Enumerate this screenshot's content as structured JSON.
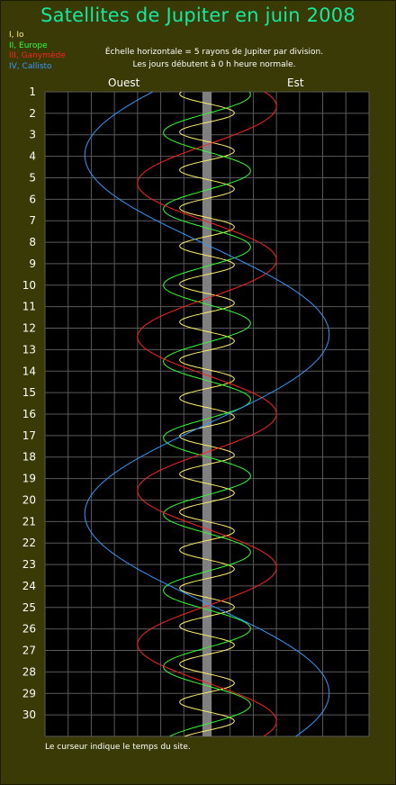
{
  "title": "Satellites de Jupiter en juin 2008",
  "legend": [
    {
      "label": "I, Io",
      "color": "#ffee66"
    },
    {
      "label": "II, Europe",
      "color": "#33ff33"
    },
    {
      "label": "III, Ganymède",
      "color": "#ff2222"
    },
    {
      "label": "IV, Callisto",
      "color": "#3399ff"
    }
  ],
  "notes": {
    "scale": "Échelle horizontale = 5 rayons de Jupiter par division.",
    "days_start": "Les jours débutent à 0 h heure normale."
  },
  "directions": {
    "west": "Ouest",
    "east": "Est"
  },
  "footer": "Le curseur indique le temps du site.",
  "colors": {
    "background": "#3a3a06",
    "plot_background": "#000000",
    "grid": "#5a5a5a",
    "jupiter_band": "#808080",
    "title": "#16e8a0"
  },
  "chart_data": {
    "type": "line",
    "title": "Satellites de Jupiter en juin 2008",
    "xlabel": "",
    "ylabel": "",
    "x_unit": "Jupiter radii (5 per division)",
    "xlim": [
      -35,
      35
    ],
    "ylim": [
      1,
      31
    ],
    "y_ticks": [
      1,
      2,
      3,
      4,
      5,
      6,
      7,
      8,
      9,
      10,
      11,
      12,
      13,
      14,
      15,
      16,
      17,
      18,
      19,
      20,
      21,
      22,
      23,
      24,
      25,
      26,
      27,
      28,
      29,
      30
    ],
    "grid": true,
    "y_direction": "down",
    "jupiter_band_halfwidth": 1,
    "series": [
      {
        "name": "I, Io",
        "amplitude": 5.9,
        "period_days": 1.769,
        "phase_day": 1.1,
        "color": "#ffee66"
      },
      {
        "name": "II, Europe",
        "amplitude": 9.4,
        "period_days": 3.551,
        "phase_day": 2.9,
        "color": "#33ff33"
      },
      {
        "name": "III, Ganymède",
        "amplitude": 15.0,
        "period_days": 7.155,
        "phase_day": 5.25,
        "color": "#ff2222"
      },
      {
        "name": "IV, Callisto",
        "amplitude": 26.4,
        "period_days": 16.689,
        "phase_day": 3.95,
        "color": "#3399ff"
      }
    ]
  }
}
